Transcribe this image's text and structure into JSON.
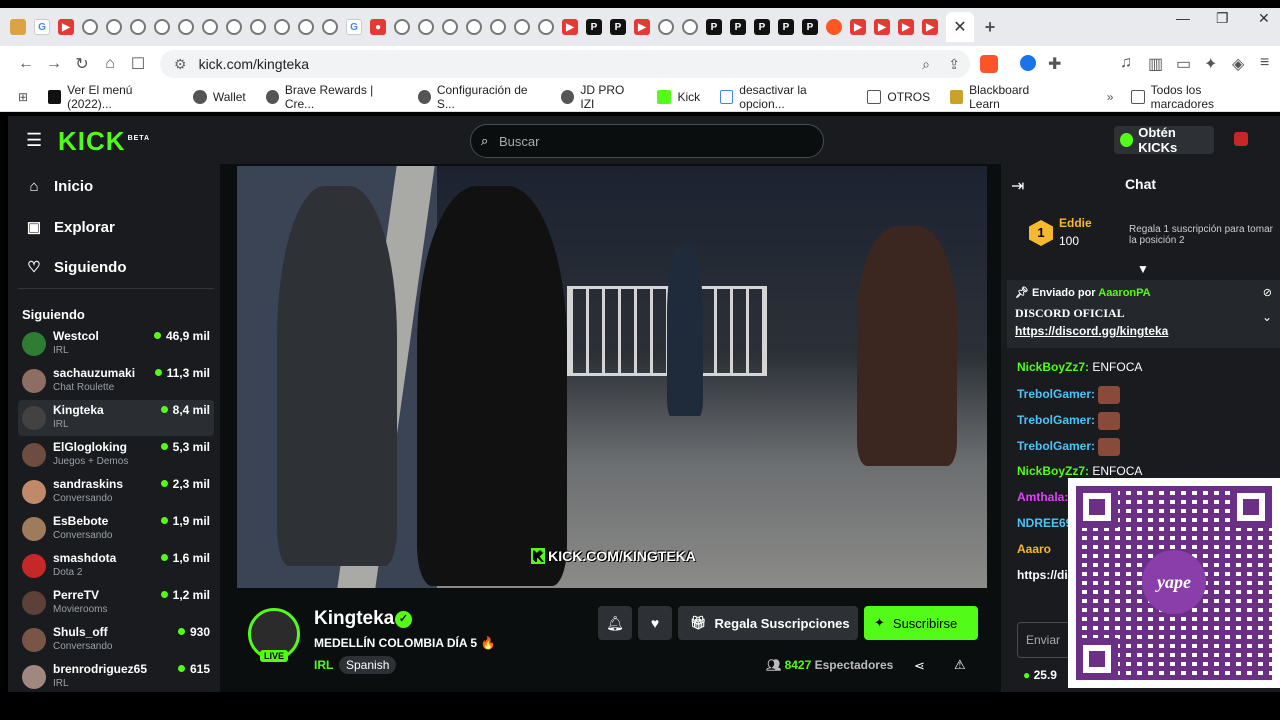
{
  "browser": {
    "url": "kick.com/kingteka",
    "bookmarks": [
      "Ver El menú (2022)...",
      "Wallet",
      "Brave Rewards | Cre...",
      "Configuración de S...",
      "JD PRO IZI",
      "Kick",
      "desactivar la opcion...",
      "OTROS",
      "Blackboard Learn",
      "Todos los marcadores"
    ]
  },
  "header": {
    "logo": "KICK",
    "logo_sup": "BETA",
    "search_placeholder": "Buscar",
    "get_kicks": "Obtén KICKs"
  },
  "sidebar": {
    "nav": [
      "Inicio",
      "Explorar",
      "Siguiendo"
    ],
    "section": "Siguiendo",
    "following": [
      {
        "name": "Westcol",
        "category": "IRL",
        "viewers": "46,9 mil",
        "color": "#2e7d32"
      },
      {
        "name": "sachauzumaki",
        "category": "Chat Roulette",
        "viewers": "11,3 mil",
        "color": "#8d6e63"
      },
      {
        "name": "Kingteka",
        "category": "IRL",
        "viewers": "8,4 mil",
        "color": "#424242"
      },
      {
        "name": "ElGlogloking",
        "category": "Juegos + Demos",
        "viewers": "5,3 mil",
        "color": "#6d4c41"
      },
      {
        "name": "sandraskins",
        "category": "Conversando",
        "viewers": "2,3 mil",
        "color": "#c08a6a"
      },
      {
        "name": "EsBebote",
        "category": "Conversando",
        "viewers": "1,9 mil",
        "color": "#9e7b5c"
      },
      {
        "name": "smashdota",
        "category": "Dota 2",
        "viewers": "1,6 mil",
        "color": "#c62828"
      },
      {
        "name": "PerreTV",
        "category": "Movierooms",
        "viewers": "1,2 mil",
        "color": "#5d4037"
      },
      {
        "name": "Shuls_off",
        "category": "Conversando",
        "viewers": "930",
        "color": "#795548"
      },
      {
        "name": "brenrodriguez65",
        "category": "IRL",
        "viewers": "615",
        "color": "#a1887f"
      }
    ]
  },
  "video": {
    "watermark_site": "K",
    "watermark": "KICK.COM/KINGTEKA"
  },
  "channel": {
    "name": "Kingteka",
    "live": "LIVE",
    "title": "MEDELLÍN COLOMBIA DÍA 5 🔥",
    "category": "IRL",
    "tag": "Spanish",
    "gift_label": "Regala Suscripciones",
    "subscribe_label": "Suscribirse",
    "viewers_count": "8427",
    "viewers_label": "Espectadores"
  },
  "chat": {
    "title": "Chat",
    "leader": {
      "rank": "1",
      "name": "Eddie",
      "points": "100",
      "promo": "Regala 1 suscripción para tomar la posición 2"
    },
    "pinned": {
      "by_label": "Enviado por",
      "by_user": "AaaronPA",
      "title": "DISCORD OFICIAL",
      "link": "https://discord.gg/kingteka"
    },
    "messages": [
      {
        "user": "NickBoyZz7:",
        "text": "ENFOCA",
        "color": "#53fc18"
      },
      {
        "user": "TrebolGamer:",
        "text": "",
        "color": "#4fc3f7"
      },
      {
        "user": "TrebolGamer:",
        "text": "",
        "color": "#4fc3f7"
      },
      {
        "user": "TrebolGamer:",
        "text": "",
        "color": "#4fc3f7"
      },
      {
        "user": "NickBoyZz7:",
        "text": "ENFOCA",
        "color": "#53fc18"
      },
      {
        "user": "Amthala:",
        "text": "",
        "color": "#e040fb"
      },
      {
        "user": "NDREE69",
        "text": "",
        "color": "#4fc3f7"
      },
      {
        "user": "Aaaro",
        "text": "",
        "color": "#f5b82e"
      },
      {
        "user": "https://dis",
        "text": "",
        "color": "#ffffff"
      }
    ],
    "send_placeholder": "Enviar",
    "balance": "25.9"
  },
  "qr": {
    "brand": "yape"
  }
}
